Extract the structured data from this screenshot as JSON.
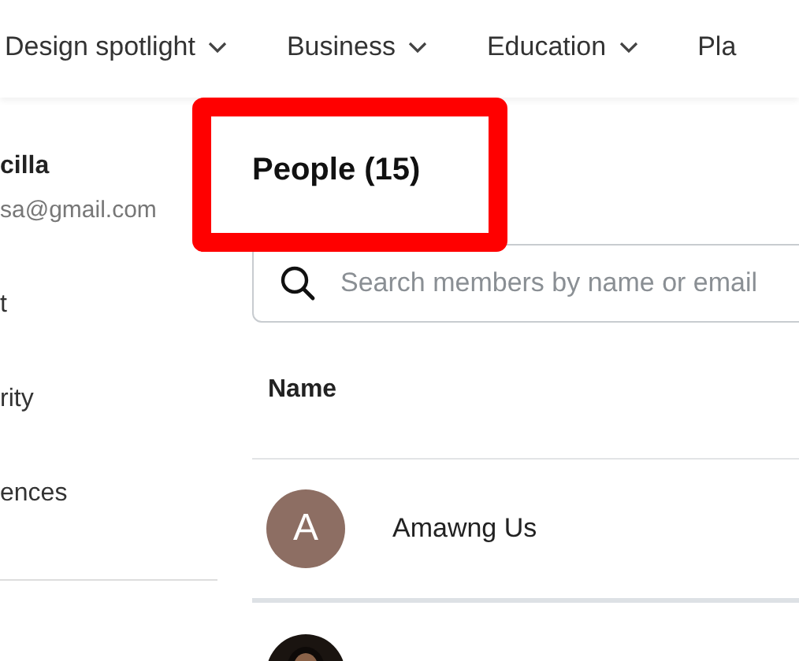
{
  "nav": [
    {
      "label": "Design spotlight",
      "dropdown": true
    },
    {
      "label": "Business",
      "dropdown": true
    },
    {
      "label": "Education",
      "dropdown": true
    },
    {
      "label": "Pla",
      "dropdown": false
    }
  ],
  "sidebar": {
    "user_name": "cilla",
    "user_email": "sa@gmail.com",
    "items": [
      {
        "label": "t"
      },
      {
        "label": "rity"
      },
      {
        "label": "ences"
      }
    ]
  },
  "heading": "People (15)",
  "highlighted": true,
  "search": {
    "placeholder": "Search members by name or email"
  },
  "table": {
    "columns": [
      "Name"
    ],
    "rows": [
      {
        "initial": "A",
        "color": "#8d6e63",
        "name": "Amawng Us",
        "kind": "initial"
      },
      {
        "kind": "picture"
      }
    ]
  }
}
